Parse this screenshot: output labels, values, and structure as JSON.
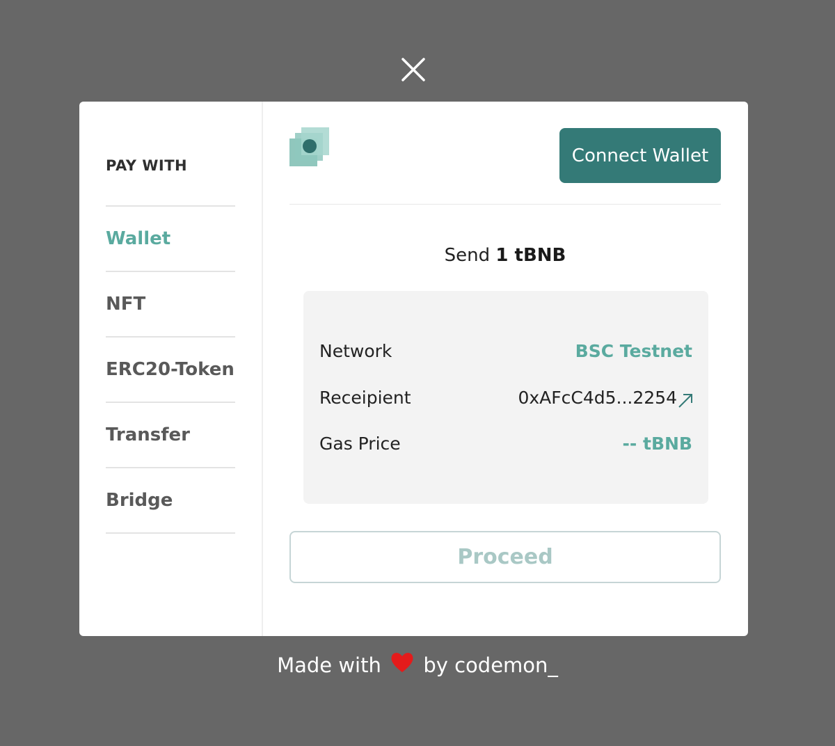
{
  "close": {
    "icon": "close-icon"
  },
  "sidebar": {
    "heading": "PAY WITH",
    "items": [
      {
        "label": "Wallet",
        "active": true
      },
      {
        "label": "NFT",
        "active": false
      },
      {
        "label": "ERC20-Token",
        "active": false
      },
      {
        "label": "Transfer",
        "active": false
      },
      {
        "label": "Bridge",
        "active": false
      }
    ]
  },
  "header": {
    "logo_icon": "stacked-squares-logo",
    "connect_label": "Connect Wallet"
  },
  "send": {
    "prefix": "Send",
    "amount": "1 tBNB"
  },
  "details": {
    "network_label": "Network",
    "network_value": "BSC Testnet",
    "recipient_label": "Receipient",
    "recipient_value": "0xAFcC4d5...2254",
    "recipient_link_icon": "external-link-arrow-icon",
    "gas_label": "Gas Price",
    "gas_value": "-- tBNB"
  },
  "proceed_label": "Proceed",
  "footer": {
    "before": "Made with",
    "heart_icon": "heart-icon",
    "after": "by codemon_"
  },
  "colors": {
    "accent": "#347a77",
    "teal_text": "#5aaa9f",
    "backdrop": "#676767"
  }
}
